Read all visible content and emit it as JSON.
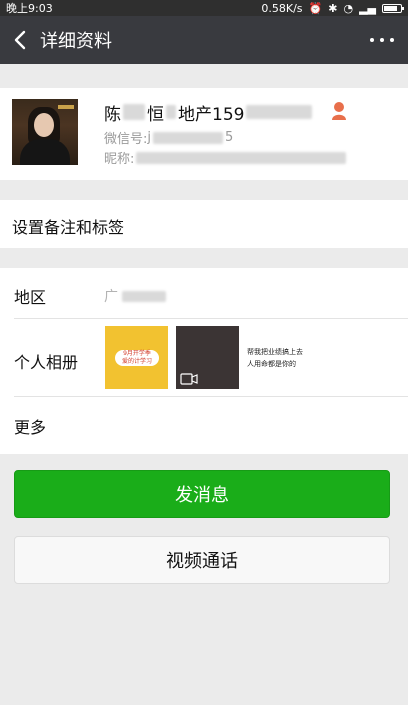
{
  "status_bar": {
    "time": "晚上9:03",
    "speed": "0.58K/s"
  },
  "nav": {
    "title": "详细资料"
  },
  "profile": {
    "name_prefix": "陈",
    "name_middle": "恒",
    "name_suffix": "地产159",
    "wechat_id_label": "微信号: ",
    "wechat_id_visible": "j",
    "wechat_id_tail": "5",
    "nickname_label": "昵称: "
  },
  "remark": {
    "label": "设置备注和标签"
  },
  "info": {
    "region_label": "地区",
    "region_value_visible": "广",
    "album_label": "个人相册",
    "more_label": "更多",
    "album_thumbs": [
      {
        "title": "9月开学季",
        "line2": "爱的计学习"
      },
      {
        "title": ""
      },
      {
        "line1": "帮我把业绩搞上去",
        "line2": "人用命都是你的"
      }
    ]
  },
  "actions": {
    "send_message": "发消息",
    "video_call": "视频通话"
  },
  "colors": {
    "nav_bg": "#393a3f",
    "primary_green": "#1aad19",
    "page_bg": "#ebebeb"
  }
}
